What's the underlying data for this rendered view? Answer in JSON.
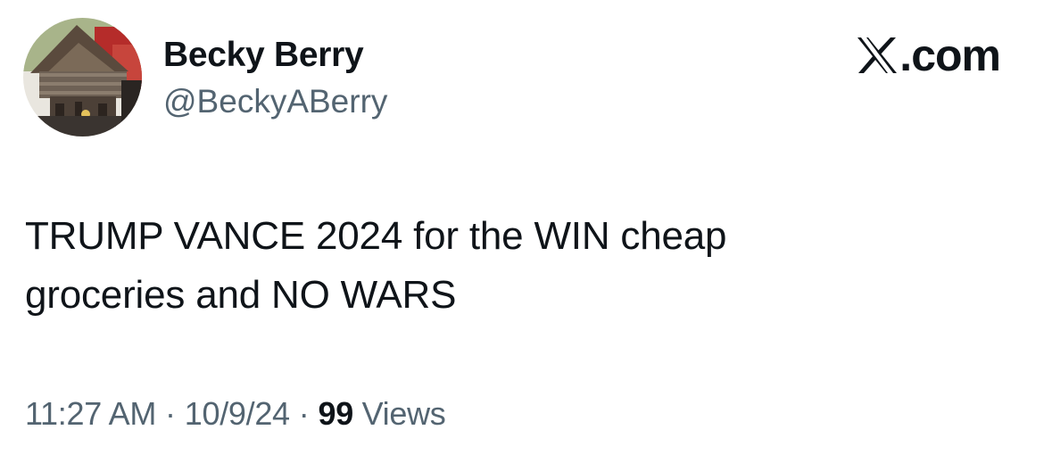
{
  "author": {
    "name": "Becky Berry",
    "handle": "@BeckyABerry"
  },
  "site": {
    "label": ".com",
    "icon": "x-logo-icon"
  },
  "tweet": {
    "text_line1": "TRUMP VANCE 2024 for the WIN cheap",
    "text_line2": "groceries and NO WARS"
  },
  "meta": {
    "time": "11:27 AM",
    "separator": "·",
    "date": "10/9/24",
    "views_count": "99",
    "views_label": "Views"
  }
}
